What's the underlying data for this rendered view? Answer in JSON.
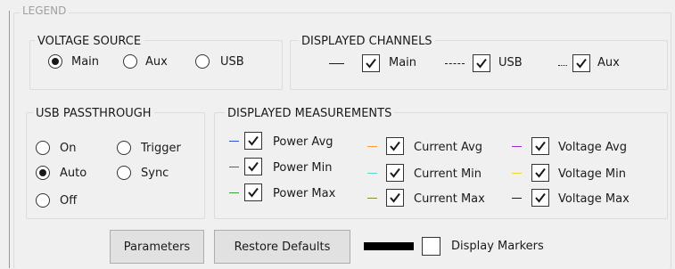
{
  "legend_title": "LEGEND",
  "voltage_source": {
    "title": "VOLTAGE SOURCE",
    "options": [
      {
        "label": "Main",
        "checked": true
      },
      {
        "label": "Aux",
        "checked": false
      },
      {
        "label": "USB",
        "checked": false
      }
    ]
  },
  "displayed_channels": {
    "title": "DISPLAYED CHANNELS",
    "channels": [
      {
        "label": "Main",
        "checked": true,
        "line_style": "solid"
      },
      {
        "label": "USB",
        "checked": true,
        "line_style": "dashed"
      },
      {
        "label": "Aux",
        "checked": true,
        "line_style": "dotted"
      }
    ]
  },
  "usb_passthrough": {
    "title": "USB PASSTHROUGH",
    "options": [
      {
        "label": "On",
        "checked": false
      },
      {
        "label": "Trigger",
        "checked": false
      },
      {
        "label": "Auto",
        "checked": true
      },
      {
        "label": "Sync",
        "checked": false
      },
      {
        "label": "Off",
        "checked": false
      }
    ]
  },
  "displayed_measurements": {
    "title": "DISPLAYED MEASUREMENTS",
    "items": [
      {
        "label": "Power Avg",
        "checked": true,
        "color": "#2f4fd8"
      },
      {
        "label": "Power Min",
        "checked": true,
        "color": "#e0262b"
      },
      {
        "label": "Power Max",
        "checked": true,
        "color": "#3aa33a"
      },
      {
        "label": "Current Avg",
        "checked": true,
        "color": "#f59a3a"
      },
      {
        "label": "Current Min",
        "checked": true,
        "color": "#5fd6c6"
      },
      {
        "label": "Current Max",
        "checked": true,
        "color": "#8a8a3a"
      },
      {
        "label": "Voltage Avg",
        "checked": true,
        "color": "#9b2fc9"
      },
      {
        "label": "Voltage Min",
        "checked": true,
        "color": "#f2d23a"
      },
      {
        "label": "Voltage Max",
        "checked": true,
        "color": "#1a1a1a"
      }
    ]
  },
  "buttons": {
    "parameters": "Parameters",
    "restore_defaults": "Restore Defaults"
  },
  "markers": {
    "label": "Display Markers",
    "checked": false,
    "swatch_color": "#000000"
  }
}
